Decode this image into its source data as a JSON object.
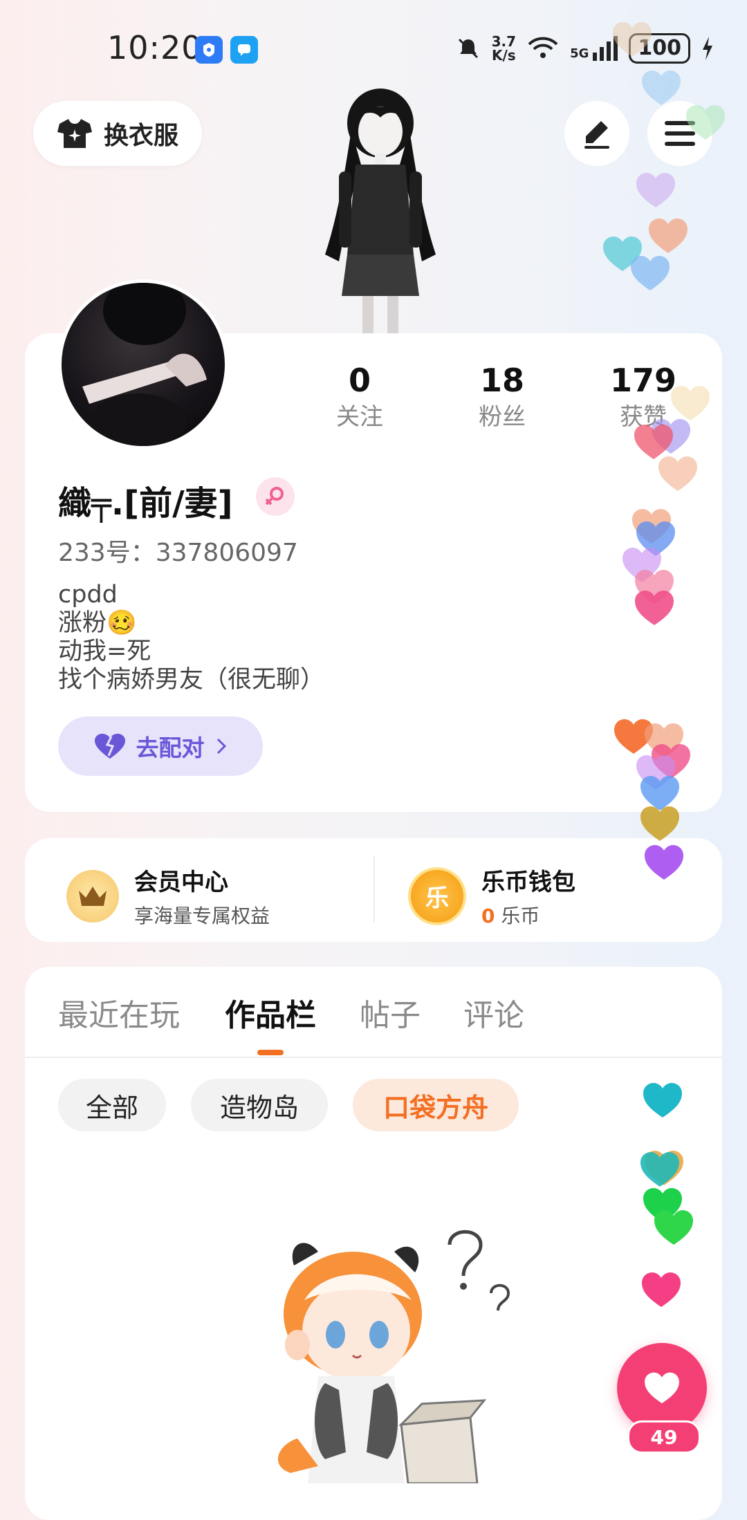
{
  "status_bar": {
    "time": "10:20",
    "net_speed_value": "3.7",
    "net_speed_unit": "K/s",
    "network": "5G",
    "battery": "100"
  },
  "top_bar": {
    "outfit_label": "换衣服",
    "edit_icon": "pen-icon",
    "menu_icon": "hamburger-menu-icon"
  },
  "profile": {
    "stats": [
      {
        "value": "0",
        "label": "关注"
      },
      {
        "value": "18",
        "label": "粉丝"
      },
      {
        "value": "179",
        "label": "获赞"
      }
    ],
    "username": "織╤.[前/妻]",
    "uid": "233号：337806097",
    "bio": [
      "cpdd",
      "涨粉🥴",
      "动我=死",
      "找个病娇男友（很无聊）"
    ],
    "match_button": "去配对"
  },
  "services": {
    "vip_title": "会员中心",
    "vip_sub": "享海量专属权益",
    "vip_coin_glyph": "crown-icon",
    "wallet_title": "乐币钱包",
    "wallet_amount": "0",
    "wallet_unit": "乐币",
    "wallet_coin_char": "乐"
  },
  "content": {
    "tabs": [
      "最近在玩",
      "作品栏",
      "帖子",
      "评论"
    ],
    "active_tab": "作品栏",
    "chips": [
      "全部",
      "造物岛",
      "口袋方舟"
    ],
    "active_chip": "口袋方舟"
  },
  "like": {
    "count": "49"
  },
  "colors": {
    "accent_orange": "#f36f21",
    "like_pink": "#f43f74",
    "match_purple": "#6a57d8",
    "match_bg": "#e7e3fb"
  }
}
